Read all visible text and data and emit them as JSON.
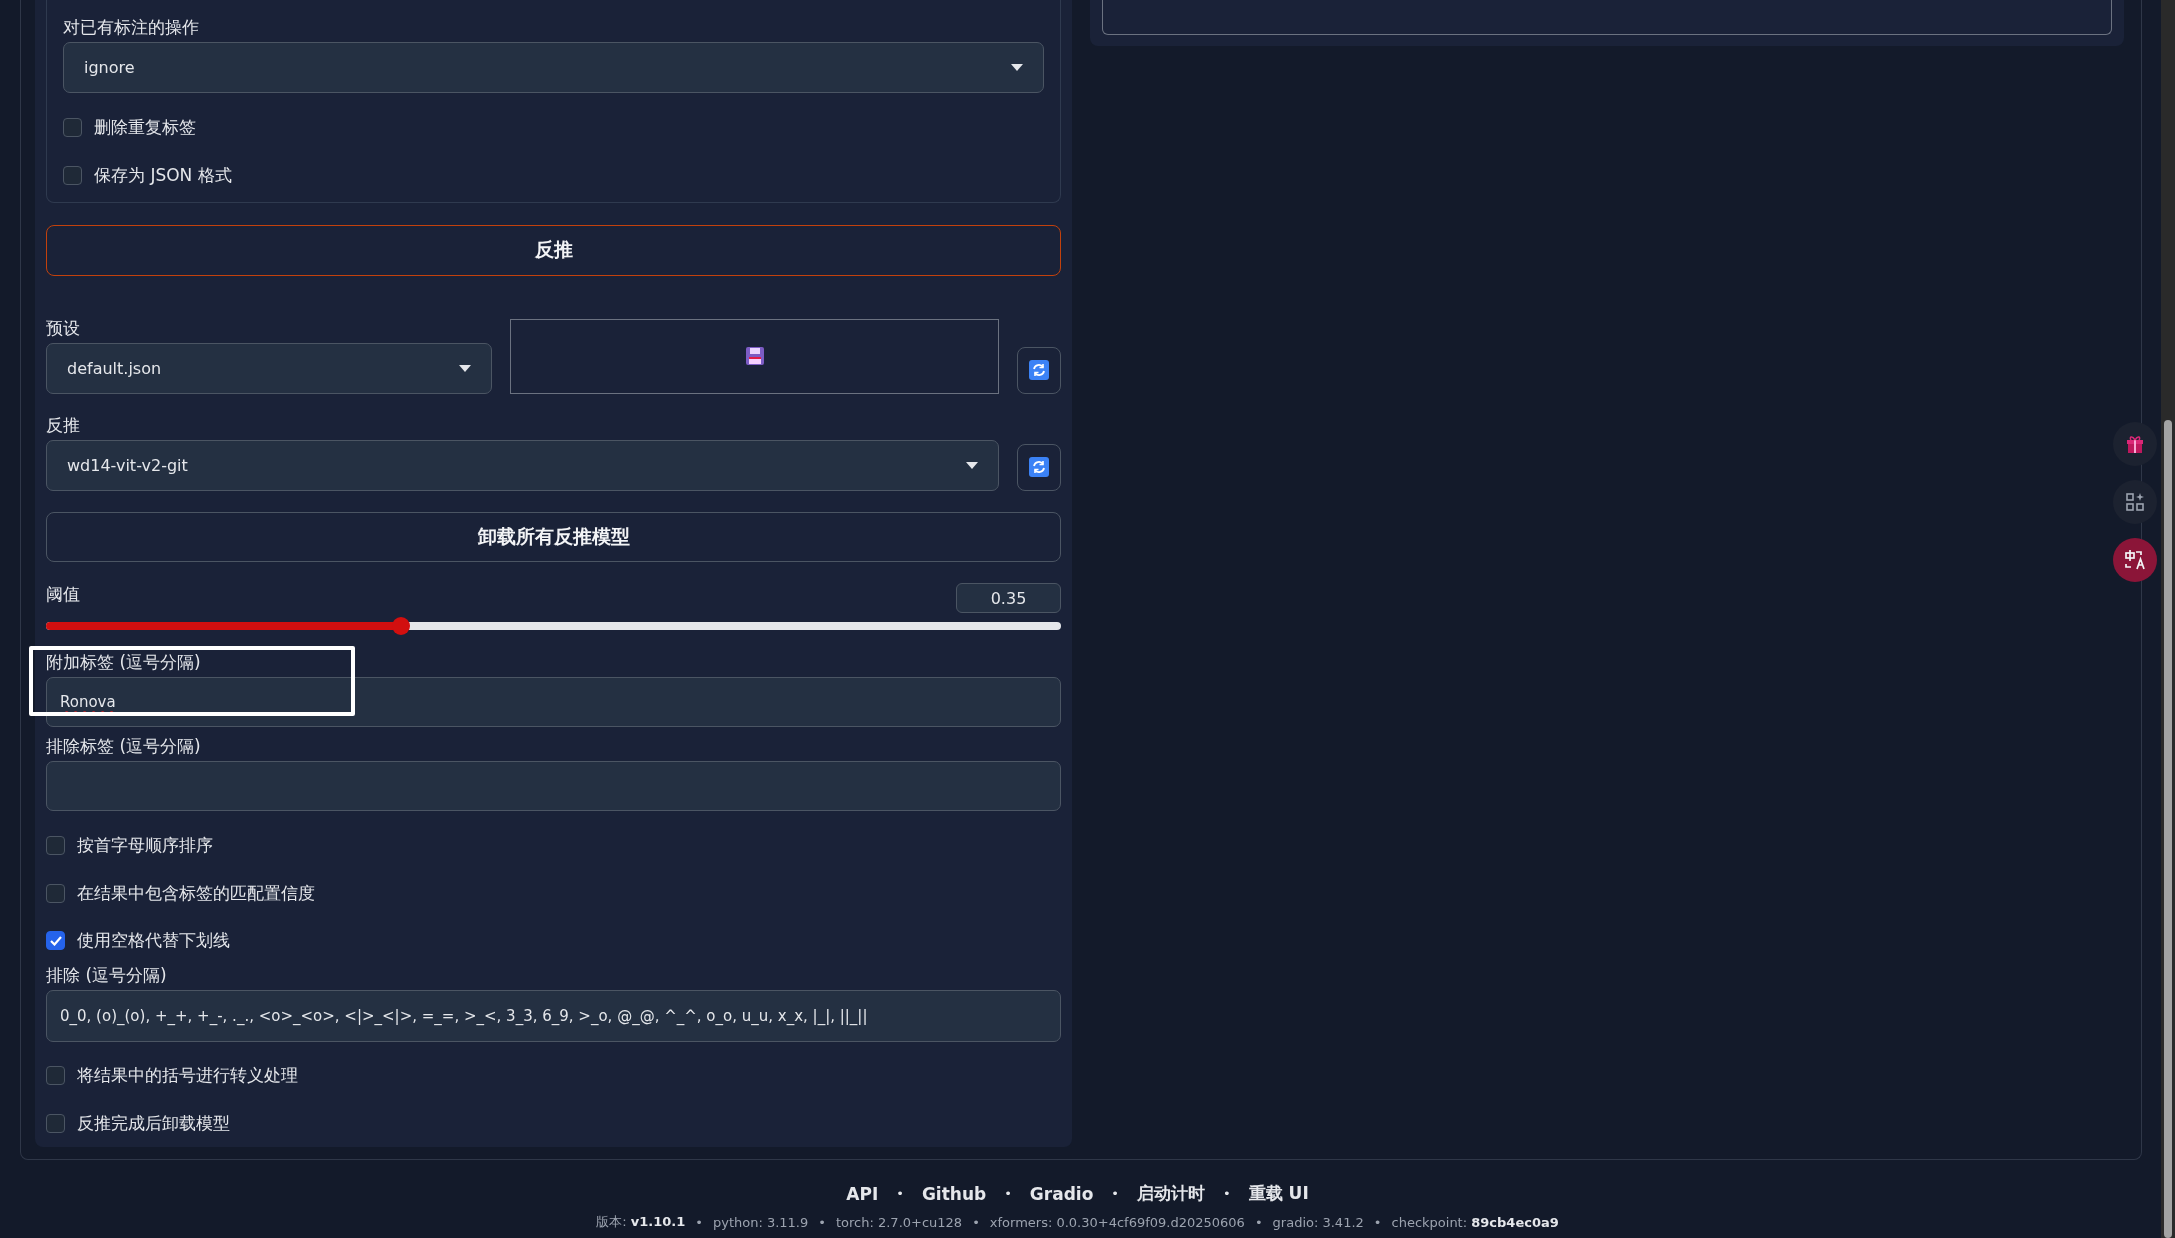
{
  "tagger_panel": {
    "existing_caption_action": {
      "label": "对已有标注的操作",
      "value": "ignore"
    },
    "group_options": [
      {
        "label": "删除重复标签",
        "checked": false
      },
      {
        "label": "保存为 JSON 格式",
        "checked": false
      }
    ],
    "interrogate_button": "反推",
    "preset": {
      "label": "预设",
      "value": "default.json"
    },
    "interrogator": {
      "label": "反推",
      "value": "wd14-vit-v2-git"
    },
    "unload_button": "卸载所有反推模型",
    "threshold": {
      "label": "阈值",
      "reading": "0.35",
      "level": 0.35
    },
    "additional_tags": {
      "label": "附加标签 (逗号分隔)",
      "value": "Ronova"
    },
    "exclude_tags": {
      "label": "排除标签 (逗号分隔)"
    },
    "options": [
      {
        "label": "按首字母顺序排序",
        "checked": false
      },
      {
        "label": "在结果中包含标签的匹配置信度",
        "checked": false
      },
      {
        "label": "使用空格代替下划线",
        "checked": true
      }
    ],
    "exclusions": {
      "label": "排除 (逗号分隔)",
      "value": "0_0, (o)_(o), +_+, +_-, ._., <o>_<o>, <|>_<|>, =_=, >_<, 3_3, 6_9, >_o, @_@, ^_^, o_o, u_u, x_x, |_|, ||_||"
    },
    "late_options": [
      {
        "label": "将结果中的括号进行转义处理",
        "checked": false
      },
      {
        "label": "反推完成后卸载模型",
        "checked": false
      }
    ]
  },
  "footer": {
    "separator": "•",
    "links": [
      "API",
      "Github",
      "Gradio",
      "启动计时",
      "重载 UI"
    ],
    "versions": [
      "版本: **v1.10.1**",
      "python: 3.11.9",
      "torch: 2.7.0+cu128",
      "xformers: 0.0.30+4cf69f09.d20250606",
      "gradio: 3.41.2",
      "checkpoint: **89cb4ec0a9**"
    ]
  }
}
